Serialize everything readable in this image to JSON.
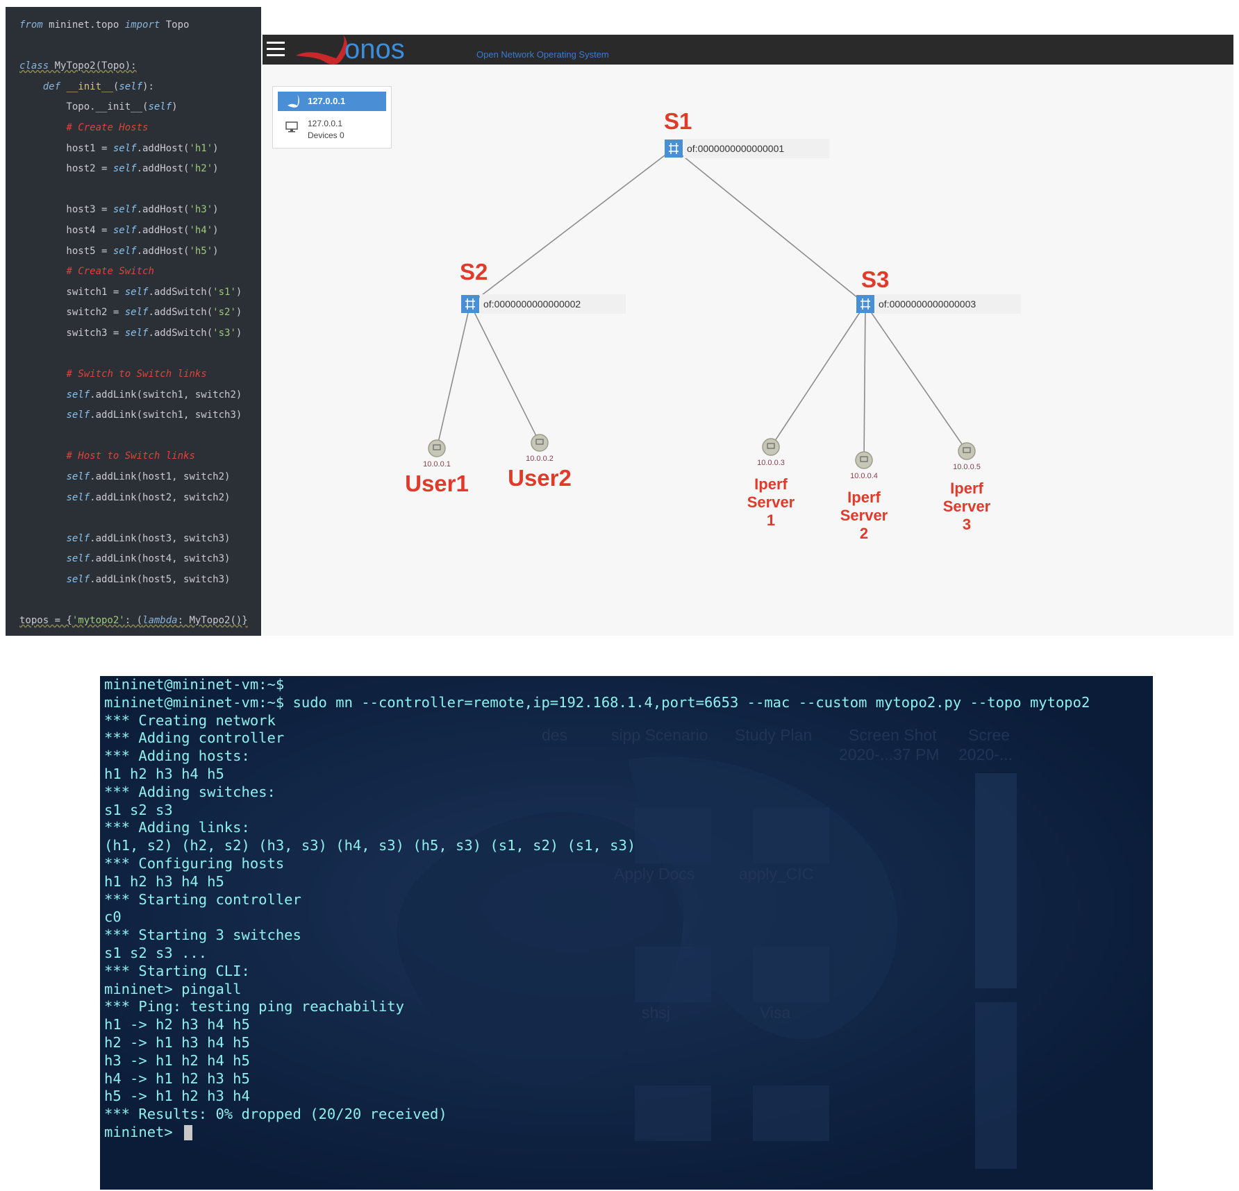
{
  "editor": {
    "lines": [
      [
        {
          "t": "from",
          "c": "kw"
        },
        {
          "t": " mininet.topo "
        },
        {
          "t": "import",
          "c": "kw"
        },
        {
          "t": " Topo"
        }
      ],
      [],
      [
        {
          "t": "class",
          "c": "kw ul"
        },
        {
          "t": " MyTopo2(Topo):",
          "c": "ul"
        }
      ],
      [
        {
          "t": "    "
        },
        {
          "t": "def",
          "c": "kw"
        },
        {
          "t": " "
        },
        {
          "t": "__init__",
          "c": "fn"
        },
        {
          "t": "("
        },
        {
          "t": "self",
          "c": "self"
        },
        {
          "t": "):"
        }
      ],
      [
        {
          "t": "        Topo.__init__("
        },
        {
          "t": "self",
          "c": "self"
        },
        {
          "t": ")"
        }
      ],
      [
        {
          "t": "        "
        },
        {
          "t": "# Create Hosts",
          "c": "cm"
        }
      ],
      [
        {
          "t": "        host1 = "
        },
        {
          "t": "self",
          "c": "self"
        },
        {
          "t": ".addHost("
        },
        {
          "t": "'h1'",
          "c": "str"
        },
        {
          "t": ")"
        }
      ],
      [
        {
          "t": "        host2 = "
        },
        {
          "t": "self",
          "c": "self"
        },
        {
          "t": ".addHost("
        },
        {
          "t": "'h2'",
          "c": "str"
        },
        {
          "t": ")"
        }
      ],
      [],
      [
        {
          "t": "        host3 = "
        },
        {
          "t": "self",
          "c": "self"
        },
        {
          "t": ".addHost("
        },
        {
          "t": "'h3'",
          "c": "str"
        },
        {
          "t": ")"
        }
      ],
      [
        {
          "t": "        host4 = "
        },
        {
          "t": "self",
          "c": "self"
        },
        {
          "t": ".addHost("
        },
        {
          "t": "'h4'",
          "c": "str"
        },
        {
          "t": ")"
        }
      ],
      [
        {
          "t": "        host5 = "
        },
        {
          "t": "self",
          "c": "self"
        },
        {
          "t": ".addHost("
        },
        {
          "t": "'h5'",
          "c": "str"
        },
        {
          "t": ")"
        }
      ],
      [
        {
          "t": "        "
        },
        {
          "t": "# Create Switch",
          "c": "cm"
        }
      ],
      [
        {
          "t": "        switch1 = "
        },
        {
          "t": "self",
          "c": "self"
        },
        {
          "t": ".addSwitch("
        },
        {
          "t": "'s1'",
          "c": "str"
        },
        {
          "t": ")"
        }
      ],
      [
        {
          "t": "        switch2 = "
        },
        {
          "t": "self",
          "c": "self"
        },
        {
          "t": ".addSwitch("
        },
        {
          "t": "'s2'",
          "c": "str"
        },
        {
          "t": ")"
        }
      ],
      [
        {
          "t": "        switch3 = "
        },
        {
          "t": "self",
          "c": "self"
        },
        {
          "t": ".addSwitch("
        },
        {
          "t": "'s3'",
          "c": "str"
        },
        {
          "t": ")"
        }
      ],
      [],
      [
        {
          "t": "        "
        },
        {
          "t": "# Switch to Switch links",
          "c": "cm"
        }
      ],
      [
        {
          "t": "        "
        },
        {
          "t": "self",
          "c": "self"
        },
        {
          "t": ".addLink(switch1, switch2)"
        }
      ],
      [
        {
          "t": "        "
        },
        {
          "t": "self",
          "c": "self"
        },
        {
          "t": ".addLink(switch1, switch3)"
        }
      ],
      [],
      [
        {
          "t": "        "
        },
        {
          "t": "# Host to Switch links",
          "c": "cm"
        }
      ],
      [
        {
          "t": "        "
        },
        {
          "t": "self",
          "c": "self"
        },
        {
          "t": ".addLink(host1, switch2)"
        }
      ],
      [
        {
          "t": "        "
        },
        {
          "t": "self",
          "c": "self"
        },
        {
          "t": ".addLink(host2, switch2)"
        }
      ],
      [],
      [
        {
          "t": "        "
        },
        {
          "t": "self",
          "c": "self"
        },
        {
          "t": ".addLink(host3, switch3)"
        }
      ],
      [
        {
          "t": "        "
        },
        {
          "t": "self",
          "c": "self"
        },
        {
          "t": ".addLink(host4, switch3)"
        }
      ],
      [
        {
          "t": "        "
        },
        {
          "t": "self",
          "c": "self"
        },
        {
          "t": ".addLink(host5, switch3)"
        }
      ],
      [],
      [
        {
          "t": "topos = {",
          "c": "ul"
        },
        {
          "t": "'mytopo2'",
          "c": "str ul"
        },
        {
          "t": ": (",
          "c": "ul"
        },
        {
          "t": "lambda",
          "c": "kw ul"
        },
        {
          "t": ": MyTopo2()}",
          "c": "ul"
        }
      ]
    ]
  },
  "onos": {
    "logo_text": "onos",
    "tagline": "Open Network Operating System",
    "cluster": {
      "title": "127.0.0.1",
      "ip": "127.0.0.1",
      "devices": "Devices 0"
    },
    "switches": {
      "s1": {
        "id": "of:0000000000000001",
        "label": "S1"
      },
      "s2": {
        "id": "of:0000000000000002",
        "label": "S2"
      },
      "s3": {
        "id": "of:0000000000000003",
        "label": "S3"
      }
    },
    "hosts": {
      "h1": {
        "ip": "10.0.0.1",
        "label": "User1"
      },
      "h2": {
        "ip": "10.0.0.2",
        "label": "User2"
      },
      "h3": {
        "ip": "10.0.0.3",
        "label_lines": [
          "Iperf",
          "Server",
          "1"
        ]
      },
      "h4": {
        "ip": "10.0.0.4",
        "label_lines": [
          "Iperf",
          "Server",
          "2"
        ]
      },
      "h5": {
        "ip": "10.0.0.5",
        "label_lines": [
          "Iperf",
          "Server",
          "3"
        ]
      }
    }
  },
  "terminal": {
    "lines": [
      "mininet@mininet-vm:~$",
      "mininet@mininet-vm:~$ sudo mn --controller=remote,ip=192.168.1.4,port=6653 --mac --custom mytopo2.py --topo mytopo2",
      "*** Creating network",
      "*** Adding controller",
      "*** Adding hosts:",
      "h1 h2 h3 h4 h5",
      "*** Adding switches:",
      "s1 s2 s3",
      "*** Adding links:",
      "(h1, s2) (h2, s2) (h3, s3) (h4, s3) (h5, s3) (s1, s2) (s1, s3)",
      "*** Configuring hosts",
      "h1 h2 h3 h4 h5",
      "*** Starting controller",
      "c0",
      "*** Starting 3 switches",
      "s1 s2 s3 ...",
      "*** Starting CLI:",
      "mininet> pingall",
      "*** Ping: testing ping reachability",
      "h1 -> h2 h3 h4 h5",
      "h2 -> h1 h3 h4 h5",
      "h3 -> h1 h2 h4 h5",
      "h4 -> h1 h2 h3 h5",
      "h5 -> h1 h2 h3 h4",
      "*** Results: 0% dropped (20/20 received)"
    ],
    "prompt": "mininet> ",
    "desktop_labels": {
      "des": "des",
      "sipp": "sipp Scenario",
      "study": "Study Plan",
      "screenshot": "Screen Shot",
      "screenshot_date": "2020-...37 PM",
      "scree": "Scree",
      "scree_date": "2020-...",
      "apply_docs": "Apply Docs",
      "apply_cic": "apply_CIC",
      "shsj": "shsj",
      "visa": "Visa"
    }
  },
  "colors": {
    "editor_bg": "#2b2f36",
    "onos_header": "#2a2a2a",
    "onos_accent": "#4a8fd6",
    "label_red": "#e03a2a",
    "terminal_bg": "#0c2140",
    "terminal_text": "#8ff0ee"
  }
}
